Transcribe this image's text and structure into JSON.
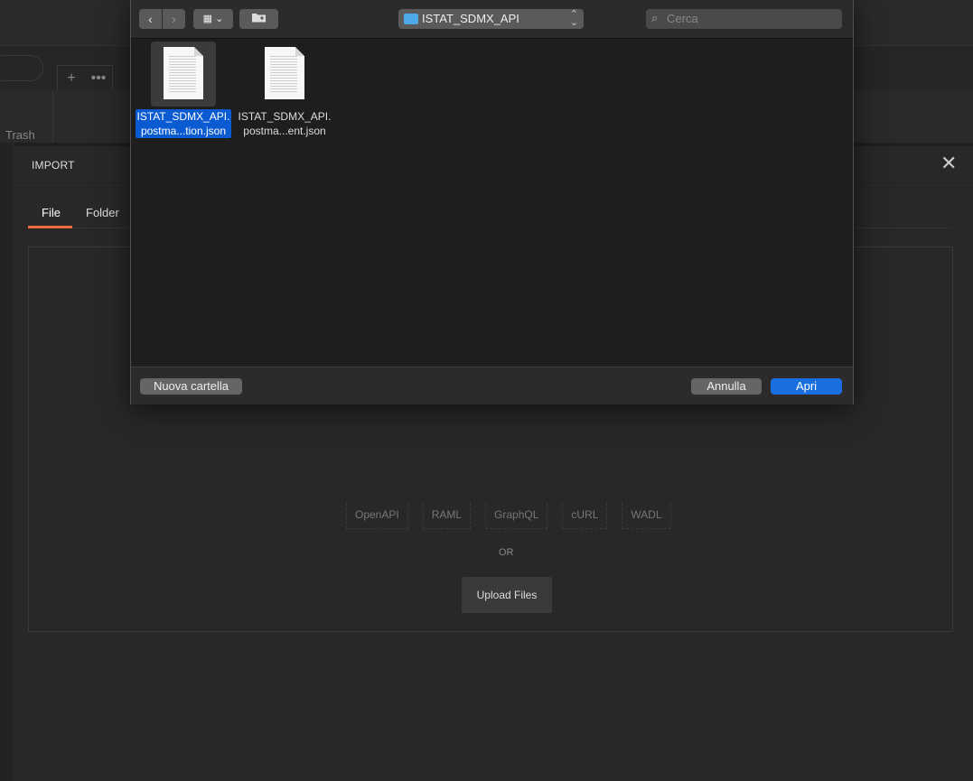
{
  "background": {
    "tab_buttons": [
      "+",
      "•••"
    ],
    "sidebar_item": "Trash"
  },
  "import_modal": {
    "title": "IMPORT",
    "close_icon": "close-icon",
    "tabs": [
      {
        "label": "File",
        "active": true
      },
      {
        "label": "Folder",
        "active": false
      }
    ],
    "accent_color": "#f26b3a",
    "formats": [
      "OpenAPI",
      "RAML",
      "GraphQL",
      "cURL",
      "WADL"
    ],
    "or_text": "OR",
    "upload_button": "Upload Files"
  },
  "file_dialog": {
    "nav_back": "‹",
    "nav_forward": "›",
    "view_icon": "grid-view-icon",
    "new_folder_icon": "new-folder-icon",
    "current_folder": "ISTAT_SDMX_API",
    "search_placeholder": "Cerca",
    "files": [
      {
        "line1": "ISTAT_SDMX_API.",
        "line2": "postma...tion.json",
        "selected": true
      },
      {
        "line1": "ISTAT_SDMX_API.",
        "line2": "postma...ent.json",
        "selected": false
      }
    ],
    "new_folder_button": "Nuova cartella",
    "cancel_button": "Annulla",
    "open_button": "Apri",
    "selection_color": "#0a5bd2"
  }
}
